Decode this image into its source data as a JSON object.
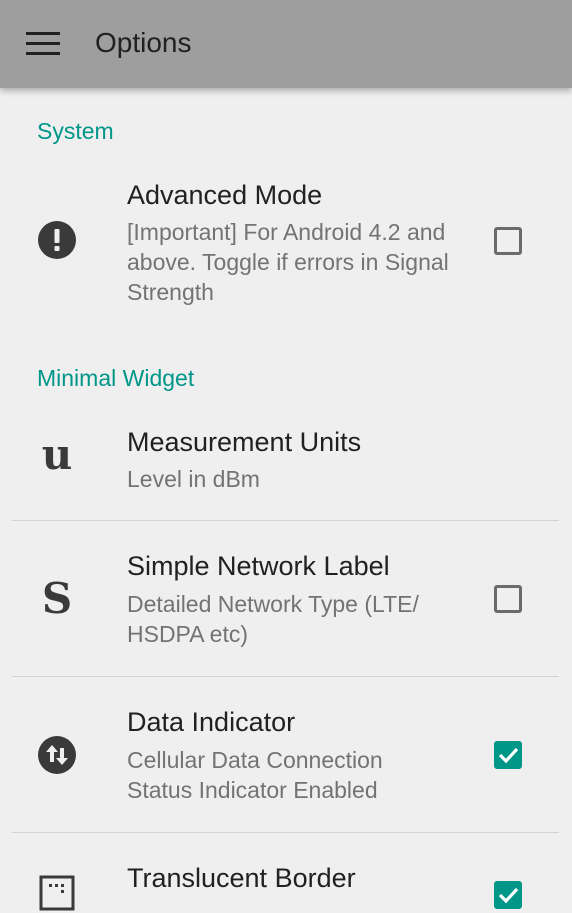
{
  "toolbar": {
    "title": "Options",
    "menu_icon": "hamburger-menu-icon"
  },
  "sections": {
    "system": {
      "header": "System"
    },
    "minimal_widget": {
      "header": "Minimal Widget"
    }
  },
  "prefs": {
    "advanced_mode": {
      "title": "Advanced Mode",
      "summary": "[Important] For Android 4.2 and above. Toggle if errors in Signal Strength",
      "icon": "exclamation-circle-icon",
      "checked": false
    },
    "measurement_units": {
      "title": "Measurement Units",
      "summary": "Level in dBm",
      "icon": "letter-u-icon",
      "glyph": "u"
    },
    "simple_network_label": {
      "title": "Simple Network Label",
      "summary": "Detailed Network Type (LTE/ HSDPA etc)",
      "icon": "letter-s-icon",
      "glyph": "S",
      "checked": false
    },
    "data_indicator": {
      "title": "Data Indicator",
      "summary": "Cellular Data Connection Status Indicator Enabled",
      "icon": "data-arrows-icon",
      "checked": true
    },
    "translucent_border": {
      "title": "Translucent Border",
      "icon": "border-dotted-icon",
      "checked": true
    }
  },
  "colors": {
    "accent": "#009688",
    "toolbar": "#9e9e9e",
    "background": "#efefef"
  }
}
